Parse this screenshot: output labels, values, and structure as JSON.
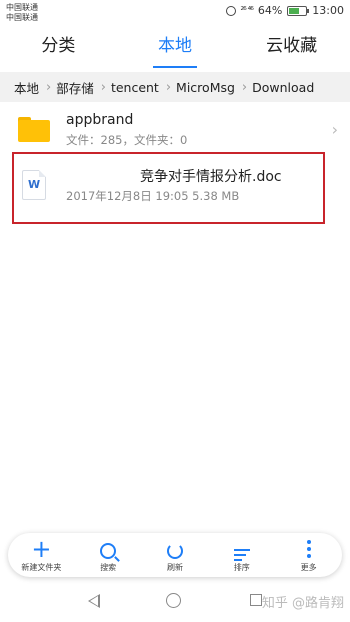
{
  "status_bar": {
    "carrier1": "中国联通",
    "carrier2": "中国联通",
    "signal": "²⁶ ⁴⁶",
    "battery": "64%",
    "battery_level": 0.64,
    "time": "13:00"
  },
  "tabs": [
    {
      "label": "分类",
      "active": false
    },
    {
      "label": "本地",
      "active": true
    },
    {
      "label": "云收藏",
      "active": false
    }
  ],
  "breadcrumb": [
    "本地",
    "部存储",
    "tencent",
    "MicroMsg",
    "Download"
  ],
  "files": [
    {
      "name": "appbrand",
      "meta": "文件：285，文件夹：0",
      "type": "folder"
    },
    {
      "name": "竞争对手情报分析.doc",
      "meta": "2017年12月8日 19:05 5.38 MB",
      "type": "word"
    }
  ],
  "toolbar": [
    {
      "label": "新建文件夹",
      "icon": "plus-icon"
    },
    {
      "label": "搜索",
      "icon": "search-icon"
    },
    {
      "label": "刷新",
      "icon": "refresh-icon"
    },
    {
      "label": "排序",
      "icon": "sort-icon"
    },
    {
      "label": "更多",
      "icon": "more-icon"
    }
  ],
  "watermark": "知乎 @路肯翔",
  "colors": {
    "accent": "#1e7ef7",
    "highlight": "#c8242b",
    "folder": "#ffc107"
  }
}
